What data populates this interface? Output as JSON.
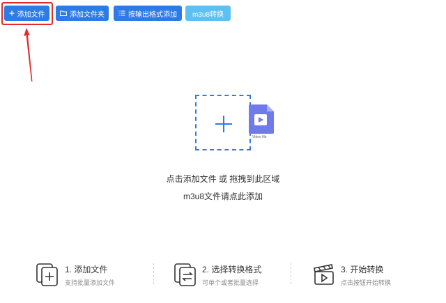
{
  "toolbar": {
    "add_file": "添加文件",
    "add_folder": "添加文件夹",
    "add_by_format": "按输出格式添加",
    "m3u8": "m3u8转换"
  },
  "dropzone": {
    "file_label": "Video file",
    "hint_line1": "点击添加文件 或 拖拽到此区域",
    "hint_line2": "m3u8文件请点此添加"
  },
  "steps": [
    {
      "title": "1. 添加文件",
      "desc": "支持批量添加文件",
      "icon": "add-file-icon"
    },
    {
      "title": "2. 选择转换格式",
      "desc": "可单个或者批量选择",
      "icon": "convert-format-icon"
    },
    {
      "title": "3. 开始转换",
      "desc": "点击按钮开始转换",
      "icon": "clapperboard-icon"
    }
  ],
  "colors": {
    "primary": "#2d7be6",
    "light": "#5cc1f2",
    "highlight": "#e22c2c",
    "file_icon": "#6f7be8"
  }
}
